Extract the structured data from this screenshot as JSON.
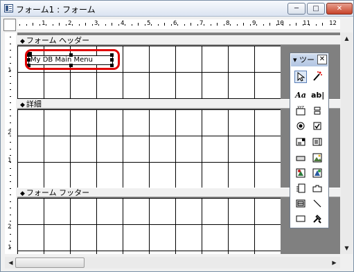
{
  "window": {
    "title": "フォーム1 : フォーム",
    "minimize_glyph": "─",
    "maximize_glyph": "□",
    "close_glyph": "✕"
  },
  "ruler": {
    "h_numbers": [
      "1",
      "2",
      "3",
      "4",
      "5",
      "6",
      "7",
      "8",
      "9",
      "10",
      "11",
      "12"
    ],
    "v_numbers": [
      "1",
      "2",
      "1",
      "2",
      "1"
    ]
  },
  "sections": {
    "header_label": "フォーム ヘッダー",
    "detail_label": "詳細",
    "footer_label": "フォーム フッター"
  },
  "form_label": {
    "text": "My DB Main Menu"
  },
  "toolbox": {
    "title": "ツー",
    "close_glyph": "✕",
    "aa_label": "Aa",
    "ab_label": "ab|"
  },
  "colors": {
    "highlight": "#e10000"
  }
}
